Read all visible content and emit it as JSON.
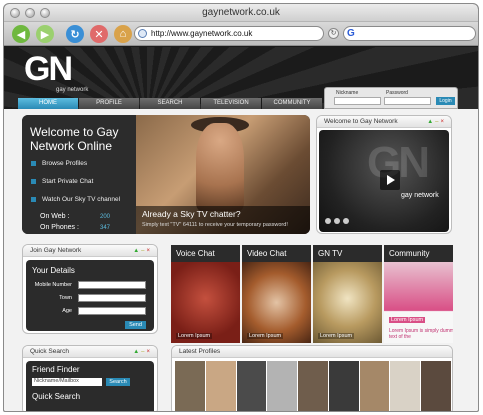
{
  "browser": {
    "window_title": "gaynetwork.co.uk",
    "url": "http://www.gaynetwork.co.uk",
    "search_glyph": "G"
  },
  "site": {
    "logo": "GN",
    "logo_sub": "gay network",
    "nav": [
      "HOME",
      "PROFILE",
      "SEARCH",
      "TELEVISION",
      "COMMUNITY"
    ],
    "login": {
      "nickname_label": "Nickname",
      "password_label": "Password",
      "button": "Login"
    },
    "welcome": {
      "title": "Welcome to Gay Network Online",
      "items": [
        "Browse Profiles",
        "Start Private Chat",
        "Watch Our Sky TV channel"
      ],
      "on_web_label": "On Web :",
      "on_web_value": "200",
      "on_phones_label": "On Phones :",
      "on_phones_value": "347",
      "promo_title": "Already a Sky TV chatter?",
      "promo_text": "Simply text \"TV\" 64111 to receive your temporary password!"
    },
    "video_panel": {
      "title": "Welcome to Gay Network",
      "overlay": "gay network"
    },
    "join": {
      "title": "Join Gay Network",
      "heading": "Your Details",
      "fields": [
        "Mobile Number",
        "Town",
        "Age"
      ],
      "send": "Send"
    },
    "tiles": [
      {
        "title": "Voice Chat",
        "label": "Lorem Ipsum",
        "color": "#8a2a1f"
      },
      {
        "title": "Video Chat",
        "label": "Lorem Ipsum",
        "color": "#a35a2a"
      },
      {
        "title": "GN TV",
        "label": "Lorem Ipsum",
        "color": "#b59a63"
      },
      {
        "title": "Community",
        "label": "Lorem Ipsum",
        "text": "Lorem Ipsum is simply dummy text of the",
        "color": "#d94f86"
      }
    ],
    "quick_search": {
      "title": "Quick Search",
      "friend_finder": "Friend Finder",
      "placeholder": "Nickname/Mailbox",
      "search_button": "Search",
      "quick_search_label": "Quick Search"
    },
    "latest_profiles": {
      "title": "Latest Profiles"
    }
  }
}
